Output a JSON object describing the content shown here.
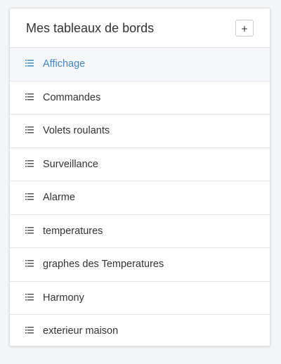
{
  "panel": {
    "title": "Mes tableaux de bords",
    "add_label": "+"
  },
  "dashboards": [
    {
      "label": "Affichage",
      "icon": "list-icon",
      "active": true
    },
    {
      "label": "Commandes",
      "icon": "list-icon",
      "active": false
    },
    {
      "label": "Volets roulants",
      "icon": "list-icon",
      "active": false
    },
    {
      "label": "Surveillance",
      "icon": "list-icon",
      "active": false
    },
    {
      "label": "Alarme",
      "icon": "list-icon",
      "active": false
    },
    {
      "label": "temperatures",
      "icon": "list-icon",
      "active": false
    },
    {
      "label": "graphes des Temperatures",
      "icon": "list-icon",
      "active": false
    },
    {
      "label": "Harmony",
      "icon": "list-icon",
      "active": false
    },
    {
      "label": "exterieur maison",
      "icon": "list-icon",
      "active": false
    }
  ],
  "colors": {
    "active_text": "#3f87c8",
    "default_text": "#333333",
    "active_icon": "#3f87c8",
    "default_icon": "#555555"
  }
}
